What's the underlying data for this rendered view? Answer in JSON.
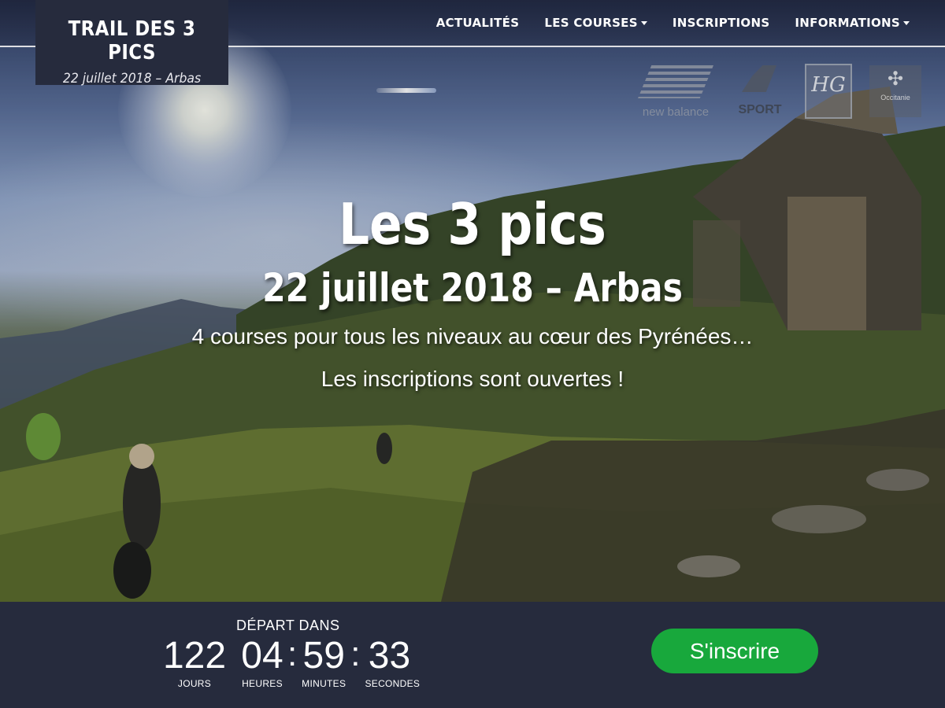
{
  "brand": {
    "title": "TRAIL DES 3 PICS",
    "subtitle": "22 juillet 2018 – Arbas"
  },
  "nav": {
    "items": [
      {
        "label": "ACTUALITÉS",
        "dropdown": false
      },
      {
        "label": "LES COURSES",
        "dropdown": true
      },
      {
        "label": "INSCRIPTIONS",
        "dropdown": false
      },
      {
        "label": "INFORMATIONS",
        "dropdown": true
      }
    ]
  },
  "sponsors": {
    "new_balance": {
      "label": "new balance"
    },
    "intersport": {
      "label": "SPORT"
    },
    "hg": {
      "label": "HG"
    },
    "occitanie": {
      "label": "Occitanie"
    }
  },
  "hero": {
    "title": "Les 3 pics",
    "subtitle": "22 juillet 2018 – Arbas",
    "description": "4 courses pour tous les niveaux au cœur des Pyrénées…",
    "registration_status": "Les inscriptions sont ouvertes !"
  },
  "countdown": {
    "label": "DÉPART DANS",
    "days": {
      "value": "122",
      "unit": "JOURS"
    },
    "hours": {
      "value": "04",
      "unit": "HEURES"
    },
    "minutes": {
      "value": "59",
      "unit": "MINUTES"
    },
    "seconds": {
      "value": "33",
      "unit": "SECONDES"
    },
    "separator": ":"
  },
  "cta": {
    "label": "S'inscrire"
  },
  "colors": {
    "brand_bg": "#262b3d",
    "cta_green": "#18a83c",
    "text": "#ffffff"
  }
}
